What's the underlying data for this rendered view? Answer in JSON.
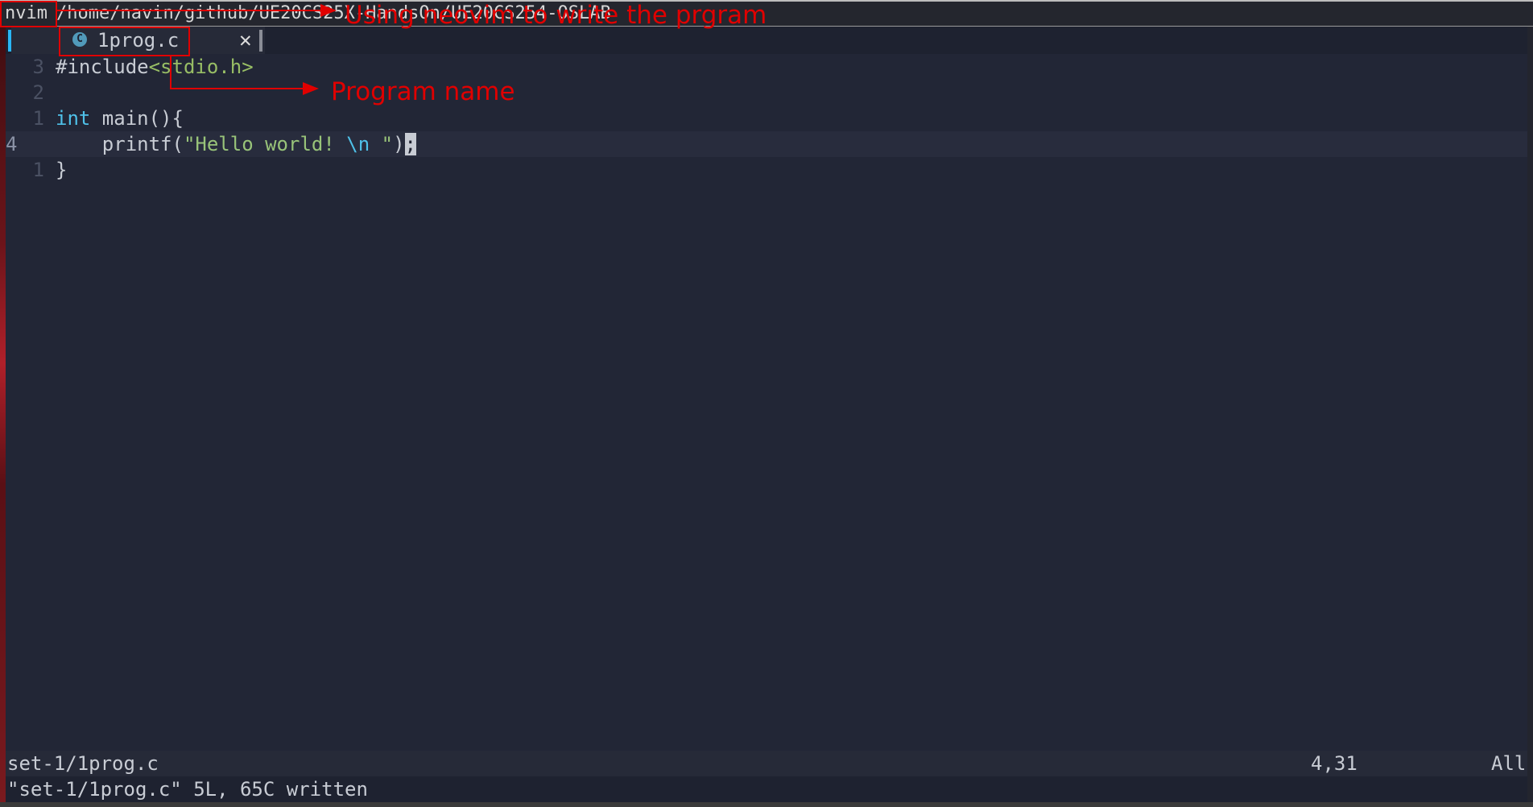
{
  "window": {
    "app_name": "nvim",
    "path": "/home/navin/github/UE20CS25X-HandsOn/UE20CS254-OSLAB"
  },
  "tabline": {
    "tabs": [
      {
        "label": "1prog.c",
        "icon": "c-file-icon",
        "icon_glyph": "C",
        "close_glyph": "✕"
      }
    ]
  },
  "editor": {
    "lines": [
      {
        "relnum": "3",
        "segments": [
          {
            "text": "#include",
            "kind": "inc"
          },
          {
            "text": "<stdio.h>",
            "kind": "hdr"
          }
        ]
      },
      {
        "relnum": "2",
        "segments": []
      },
      {
        "relnum": "1",
        "segments": [
          {
            "text": "int",
            "kind": "kw"
          },
          {
            "text": " main(){",
            "kind": "plain"
          }
        ]
      },
      {
        "relnum": "4",
        "current": true,
        "segments": [
          {
            "text": "    printf(",
            "kind": "plain"
          },
          {
            "text": "\"Hello world! ",
            "kind": "str"
          },
          {
            "text": "\\n",
            "kind": "esc"
          },
          {
            "text": " \"",
            "kind": "str"
          },
          {
            "text": ")",
            "kind": "plain"
          },
          {
            "text": ";",
            "kind": "cursor"
          }
        ]
      },
      {
        "relnum": "1",
        "segments": [
          {
            "text": "}",
            "kind": "plain"
          }
        ]
      }
    ]
  },
  "statusline": {
    "file": "set-1/1prog.c",
    "position": "4,31",
    "scroll": "All"
  },
  "cmdline": {
    "message": "\"set-1/1prog.c\" 5L, 65C written"
  },
  "annotations": {
    "nvim_note": "Using neovim to write the prgram",
    "program_note": "Program name",
    "color": "#e00000"
  },
  "theme": {
    "background": "#222636",
    "keyword": "#4fc1e9",
    "string": "#98c379",
    "accent": "#29b6f6"
  }
}
